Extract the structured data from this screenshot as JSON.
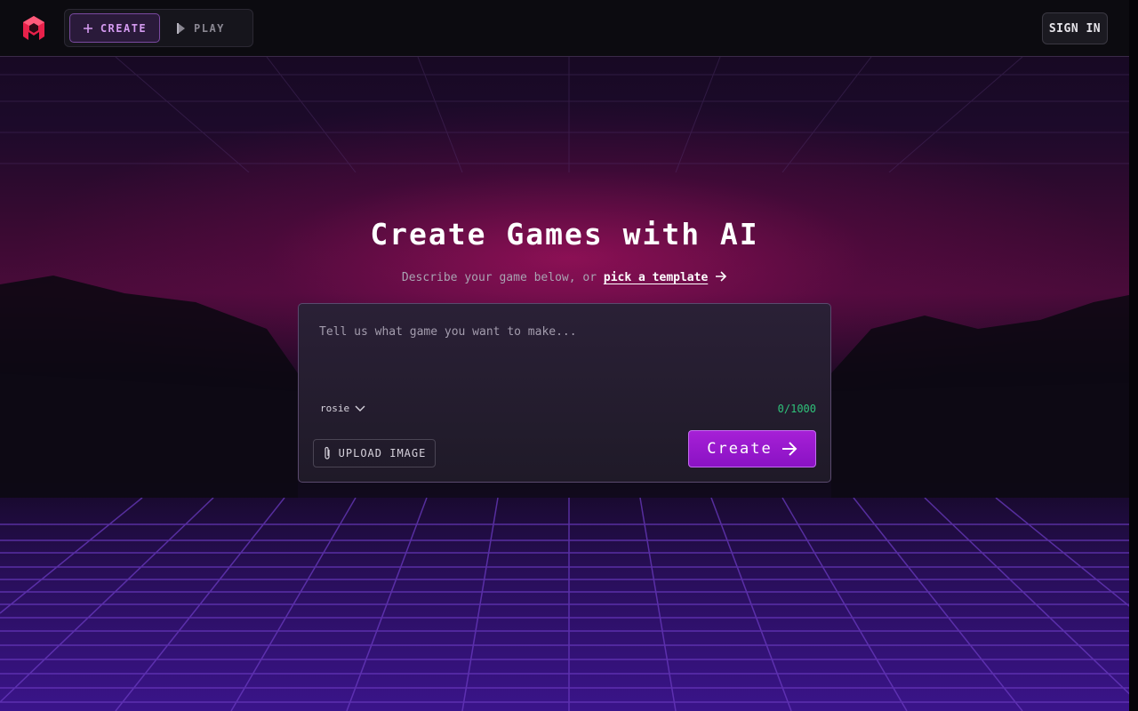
{
  "nav": {
    "create_label": "CREATE",
    "play_label": "PLAY",
    "sign_in_label": "SIGN IN"
  },
  "hero": {
    "title": "Create Games with AI",
    "subtitle_prefix": "Describe your game below, or",
    "template_link": "pick a template"
  },
  "prompt_box": {
    "placeholder": "Tell us what game you want to make...",
    "value": "",
    "model": "rosie",
    "counter": "0/1000",
    "upload_label": "UPLOAD IMAGE",
    "submit_label": "Create"
  },
  "colors": {
    "accent": "#a620d6",
    "counter": "#2fc27a",
    "logo": "#e8214a"
  },
  "icons": [
    "logo-icon",
    "plus-icon",
    "play-icon",
    "arrow-right-icon",
    "chevron-down-icon",
    "paperclip-icon"
  ]
}
